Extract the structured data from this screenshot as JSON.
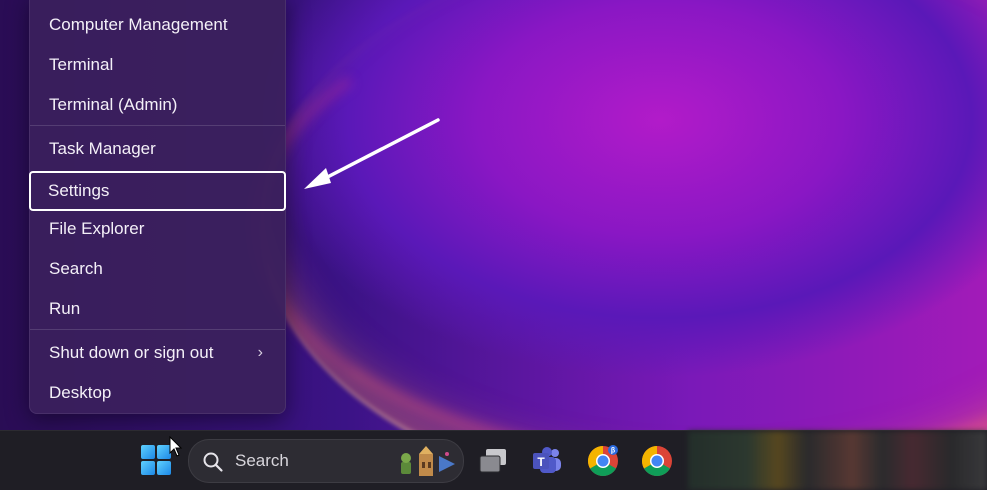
{
  "menu": {
    "items": [
      {
        "label": "Computer Management"
      },
      {
        "label": "Terminal"
      },
      {
        "label": "Terminal (Admin)"
      },
      {
        "label": "Task Manager"
      },
      {
        "label": "Settings"
      },
      {
        "label": "File Explorer"
      },
      {
        "label": "Search"
      },
      {
        "label": "Run"
      },
      {
        "label": "Shut down or sign out"
      },
      {
        "label": "Desktop"
      }
    ],
    "highlighted_item": "Settings",
    "submenu_chevron": "chevron-right-icon"
  },
  "annotation": {
    "arrow_icon": "arrow-pointer-icon",
    "color": "#ffffff"
  },
  "taskbar": {
    "start_icon": "windows-start-icon",
    "search_placeholder": "Search",
    "search_icon": "search-icon",
    "apps": [
      {
        "name": "task-view-icon"
      },
      {
        "name": "teams-icon"
      },
      {
        "name": "chrome-beta-icon"
      },
      {
        "name": "chrome-icon"
      }
    ]
  },
  "colors": {
    "menu_bg": "#3a205c",
    "taskbar_bg": "#1f1e25",
    "highlight_border": "#ffffff",
    "wallpaper_accent": "#b21bc9"
  }
}
